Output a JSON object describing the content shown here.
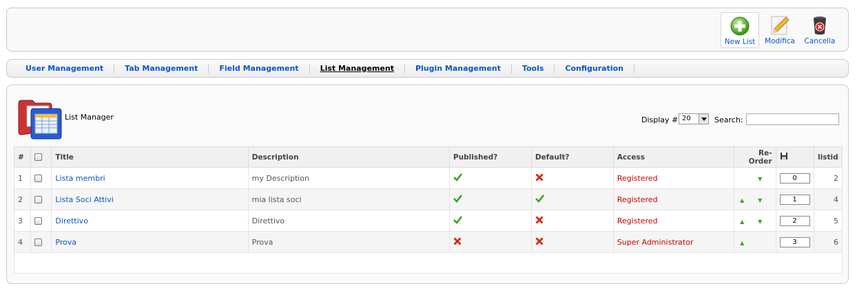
{
  "toolbar": {
    "new_label": "New List",
    "edit_label": "Modifica",
    "delete_label": "Cancella"
  },
  "submenu": [
    {
      "label": "User Management",
      "active": false
    },
    {
      "label": "Tab Management",
      "active": false
    },
    {
      "label": "Field Management",
      "active": false
    },
    {
      "label": "List Management",
      "active": true
    },
    {
      "label": "Plugin Management",
      "active": false
    },
    {
      "label": "Tools",
      "active": false
    },
    {
      "label": "Configuration",
      "active": false
    }
  ],
  "page": {
    "title": "List Manager",
    "display_label": "Display #",
    "display_value": "20",
    "search_label": "Search:",
    "search_value": ""
  },
  "table": {
    "headers": [
      "#",
      "",
      "Title",
      "Description",
      "Published?",
      "Default?",
      "Access",
      "Re-Order",
      "",
      "listid"
    ],
    "rows": [
      {
        "num": "1",
        "title": "Lista membri",
        "description": "my Description",
        "published": true,
        "default": false,
        "access": "Registered",
        "up": false,
        "down": true,
        "order": "0",
        "listid": "2"
      },
      {
        "num": "2",
        "title": "Lista Soci Attivi",
        "description": "mia lista soci",
        "published": true,
        "default": true,
        "access": "Registered",
        "up": true,
        "down": true,
        "order": "1",
        "listid": "4"
      },
      {
        "num": "3",
        "title": "Direttivo",
        "description": "Direttivo",
        "published": true,
        "default": false,
        "access": "Registered",
        "up": true,
        "down": true,
        "order": "2",
        "listid": "5"
      },
      {
        "num": "4",
        "title": "Prova",
        "description": "Prova",
        "published": false,
        "default": false,
        "access": "Super Administrator",
        "up": true,
        "down": false,
        "order": "3",
        "listid": "6"
      }
    ]
  },
  "colors": {
    "link": "#0b55c4",
    "access": "#cc0000",
    "check": "#3ca320",
    "cross": "#d42a0a"
  },
  "icons": {
    "new": "plus-circle-icon",
    "edit": "pencil-icon",
    "delete": "trash-icon",
    "published": "check-icon",
    "unpublished": "cross-icon",
    "order_save": "floppy-disk-icon"
  }
}
